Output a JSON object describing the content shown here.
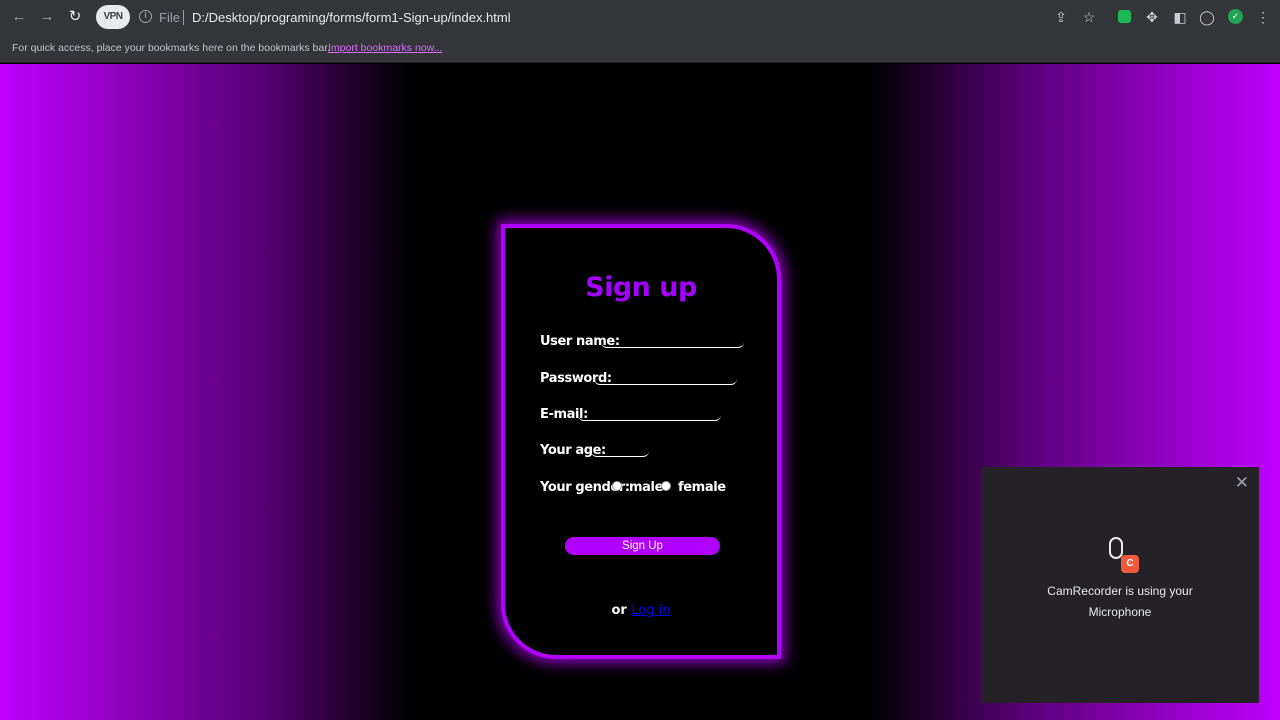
{
  "browser": {
    "vpn_label": "VPN",
    "scheme": "File",
    "url": "D:/Desktop/programing/forms/form1-Sign-up/index.html",
    "bookmarks_message": "For quick access, place your bookmarks here on the bookmarks bar.",
    "bookmarks_link": "Import bookmarks now..."
  },
  "form": {
    "title": "Sign up",
    "username_label": "User name:",
    "password_label": "Password:",
    "email_label": "E-mail:",
    "age_label": "Your age:",
    "gender_label": "Your gender:",
    "gender_options": [
      "male",
      "female"
    ],
    "submit_label": "Sign Up",
    "login_prefix": "or",
    "login_link": "Log in"
  },
  "notification": {
    "line1": "CamRecorder  is using your",
    "line2": "Microphone"
  },
  "colors": {
    "accent": "#b100ff",
    "title": "#a400ff",
    "link": "#0000ee"
  }
}
